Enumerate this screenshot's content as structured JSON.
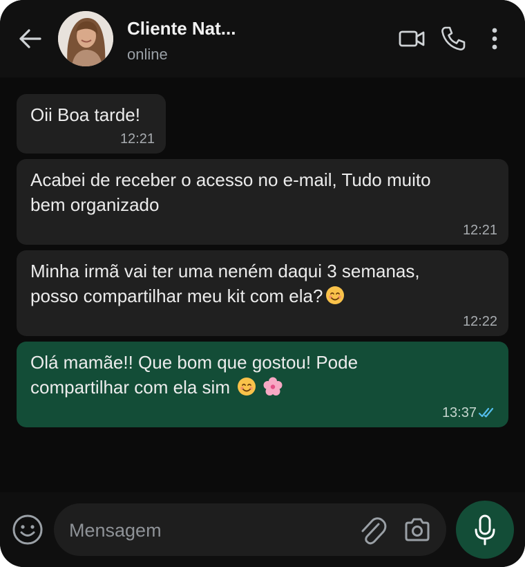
{
  "header": {
    "contact_name": "Cliente Nat...",
    "status": "online"
  },
  "icons": {
    "back": "back-arrow-icon",
    "video": "video-call-icon",
    "call": "phone-icon",
    "menu": "more-vertical-icon",
    "emoji": "emoji-icon",
    "attach": "paperclip-icon",
    "camera": "camera-icon",
    "mic": "microphone-icon"
  },
  "messages": [
    {
      "direction": "incoming",
      "text": "Oii Boa tarde!",
      "time": "12:21"
    },
    {
      "direction": "incoming",
      "text": "Acabei de receber o acesso no e-mail, Tudo muito\nbem organizado",
      "time": "12:21"
    },
    {
      "direction": "incoming",
      "text": "Minha irmã vai ter uma neném daqui 3 semanas,\nposso compartilhar meu kit com ela?",
      "emoji": [
        "smiling-face"
      ],
      "time": "12:22"
    },
    {
      "direction": "outgoing",
      "text": "Olá mamãe!! Que bom que gostou! Pode\ncompartilhar com ela sim",
      "emoji": [
        "smiling-face",
        "cherry-blossom"
      ],
      "time": "13:37",
      "read": true
    }
  ],
  "composer": {
    "placeholder": "Mensagem"
  },
  "colors": {
    "background": "#0b0b0b",
    "incoming_bubble": "#202020",
    "outgoing_bubble": "#134d37",
    "read_ticks": "#53bdeb"
  }
}
